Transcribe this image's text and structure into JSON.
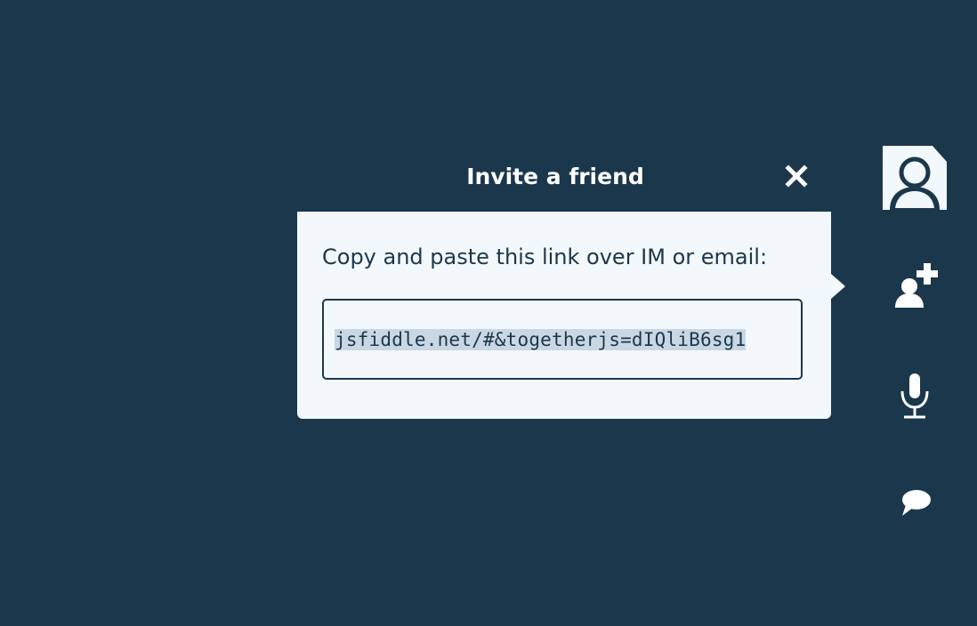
{
  "dialog": {
    "title": "Invite a friend",
    "close_icon": "close-x-icon",
    "instructions": "Copy and paste this link over IM or email:",
    "link_value": "jsfiddle.net/#&togetherjs=dIQliB6sg1"
  },
  "sidebar": {
    "items": [
      {
        "icon": "user-avatar-icon"
      },
      {
        "icon": "add-user-icon"
      },
      {
        "icon": "microphone-icon"
      },
      {
        "icon": "chat-bubble-icon"
      }
    ]
  },
  "colors": {
    "background": "#1b374c",
    "panel": "#f3f8fc",
    "text_dark": "#1b374c",
    "selection": "#c9d7e4"
  }
}
